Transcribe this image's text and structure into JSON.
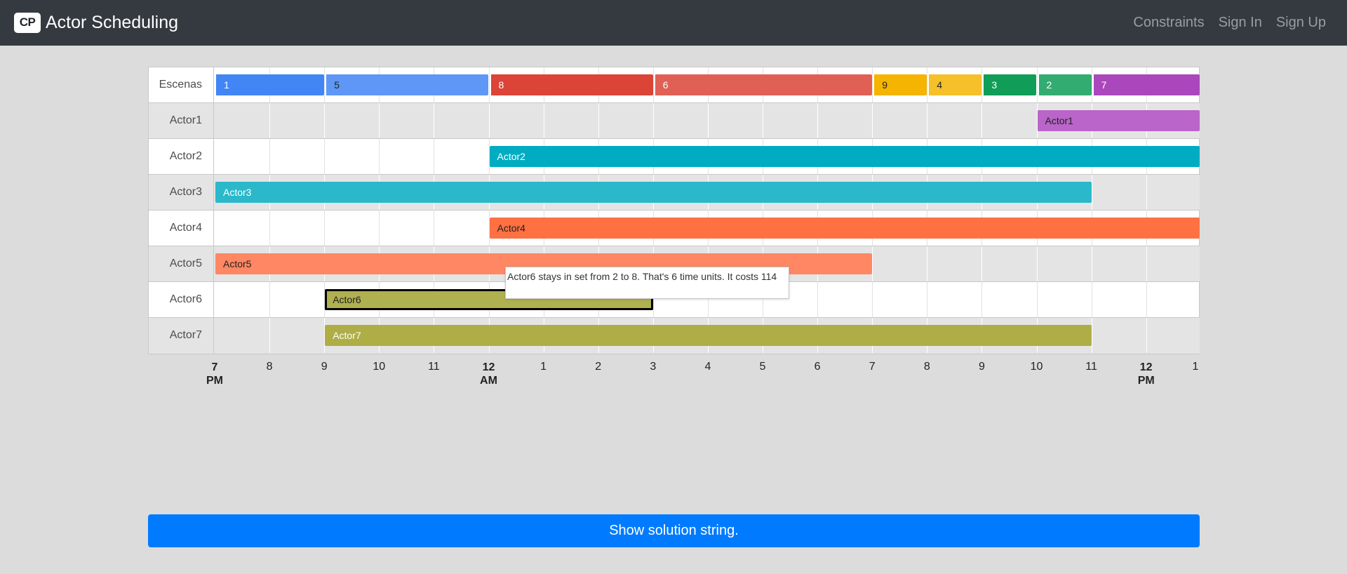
{
  "navbar": {
    "logo_text": "CP",
    "title": "Actor Scheduling",
    "links": [
      "Constraints",
      "Sign In",
      "Sign Up"
    ]
  },
  "timeline": {
    "row_labels": [
      "Escenas",
      "Actor1",
      "Actor2",
      "Actor3",
      "Actor4",
      "Actor5",
      "Actor6",
      "Actor7"
    ],
    "scenes": [
      {
        "label": "1",
        "start": 0,
        "end": 2,
        "color": "#4285f4",
        "text_color": "#ffffff"
      },
      {
        "label": "5",
        "start": 2,
        "end": 5,
        "color": "#5e97f6",
        "text_color": "#222222"
      },
      {
        "label": "8",
        "start": 5,
        "end": 8,
        "color": "#db4437",
        "text_color": "#ffffff"
      },
      {
        "label": "6",
        "start": 8,
        "end": 12,
        "color": "#e06055",
        "text_color": "#ffffff"
      },
      {
        "label": "9",
        "start": 12,
        "end": 13,
        "color": "#f4b400",
        "text_color": "#222222"
      },
      {
        "label": "4",
        "start": 13,
        "end": 14,
        "color": "#f6c02a",
        "text_color": "#222222"
      },
      {
        "label": "3",
        "start": 14,
        "end": 15,
        "color": "#0f9d58",
        "text_color": "#ffffff"
      },
      {
        "label": "2",
        "start": 15,
        "end": 16,
        "color": "#33ac71",
        "text_color": "#ffffff"
      },
      {
        "label": "7",
        "start": 16,
        "end": 18,
        "color": "#ab47bc",
        "text_color": "#ffffff"
      }
    ],
    "actors": [
      {
        "label": "Actor1",
        "start": 15,
        "end": 18,
        "color": "#b965c9",
        "text_color": "#222222"
      },
      {
        "label": "Actor2",
        "start": 5,
        "end": 18,
        "color": "#00acc1",
        "text_color": "#ffffff"
      },
      {
        "label": "Actor3",
        "start": 0,
        "end": 16,
        "color": "#2ab8ca",
        "text_color": "#ffffff"
      },
      {
        "label": "Actor4",
        "start": 5,
        "end": 18,
        "color": "#ff7043",
        "text_color": "#222222"
      },
      {
        "label": "Actor5",
        "start": 0,
        "end": 12,
        "color": "#ff8763",
        "text_color": "#222222"
      },
      {
        "label": "Actor6",
        "start": 2,
        "end": 8,
        "color": "#afb050",
        "text_color": "#222222",
        "selected": true
      },
      {
        "label": "Actor7",
        "start": 2,
        "end": 16,
        "color": "#afae46",
        "text_color": "#ffffff"
      }
    ],
    "ticks": [
      {
        "label": "7",
        "sub": "PM",
        "major": true
      },
      {
        "label": "8"
      },
      {
        "label": "9"
      },
      {
        "label": "10"
      },
      {
        "label": "11"
      },
      {
        "label": "12",
        "sub": "AM",
        "major": true
      },
      {
        "label": "1"
      },
      {
        "label": "2"
      },
      {
        "label": "3"
      },
      {
        "label": "4"
      },
      {
        "label": "5"
      },
      {
        "label": "6"
      },
      {
        "label": "7"
      },
      {
        "label": "8"
      },
      {
        "label": "9"
      },
      {
        "label": "10"
      },
      {
        "label": "11"
      },
      {
        "label": "12",
        "sub": "PM",
        "major": true
      },
      {
        "label": "1"
      }
    ],
    "tooltip": "Actor6 stays in set from 2 to 8. That's 6 time units. It costs 114"
  },
  "solution_button": "Show solution string."
}
